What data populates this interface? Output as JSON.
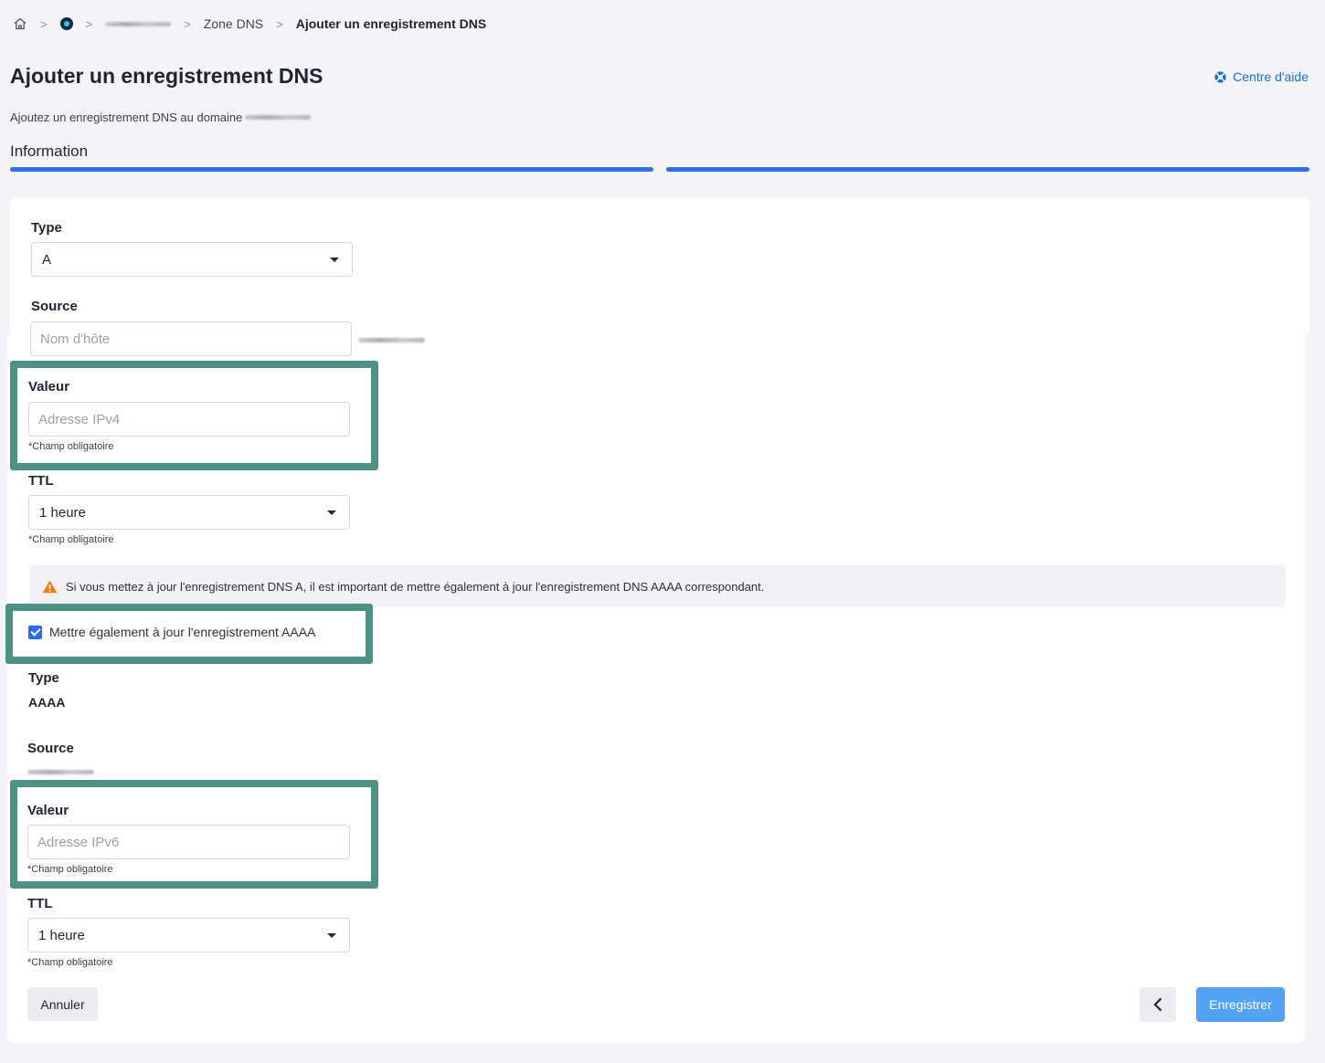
{
  "breadcrumb": {
    "zone_label": "Zone DNS",
    "current_label": "Ajouter un enregistrement DNS"
  },
  "header": {
    "title": "Ajouter un enregistrement DNS",
    "help_label": "Centre d'aide",
    "subtitle": "Ajoutez un enregistrement DNS au domaine",
    "section_label": "Information"
  },
  "form": {
    "type_label": "Type",
    "type_value": "A",
    "source_label": "Source",
    "source_placeholder": "Nom d'hôte",
    "value_label": "Valeur",
    "value_placeholder": "Adresse IPv4",
    "value_hint": "*Champ obligatoire",
    "ttl_label": "TTL",
    "ttl_value": "1 heure",
    "ttl_hint": "*Champ obligatoire"
  },
  "alert": {
    "text": "Si vous mettez à jour l'enregistrement DNS A, il est important de mettre également à jour l'enregistrement DNS AAAA correspondant."
  },
  "aaaa_checkbox": {
    "label": "Mettre également à jour l'enregistrement AAAA",
    "checked": true
  },
  "aaaa": {
    "type_label": "Type",
    "type_value": "AAAA",
    "source_label": "Source",
    "value_label": "Valeur",
    "value_placeholder": "Adresse IPv6",
    "value_hint": "*Champ obligatoire",
    "ttl_label": "TTL",
    "ttl_value": "1 heure",
    "ttl_hint": "*Champ obligatoire"
  },
  "actions": {
    "cancel_label": "Annuler",
    "save_label": "Enregistrer"
  },
  "colors": {
    "accent": "#2f6fe8",
    "highlight": "#4e9185",
    "save_button": "#52a3f5",
    "warning": "#f07d0a"
  }
}
